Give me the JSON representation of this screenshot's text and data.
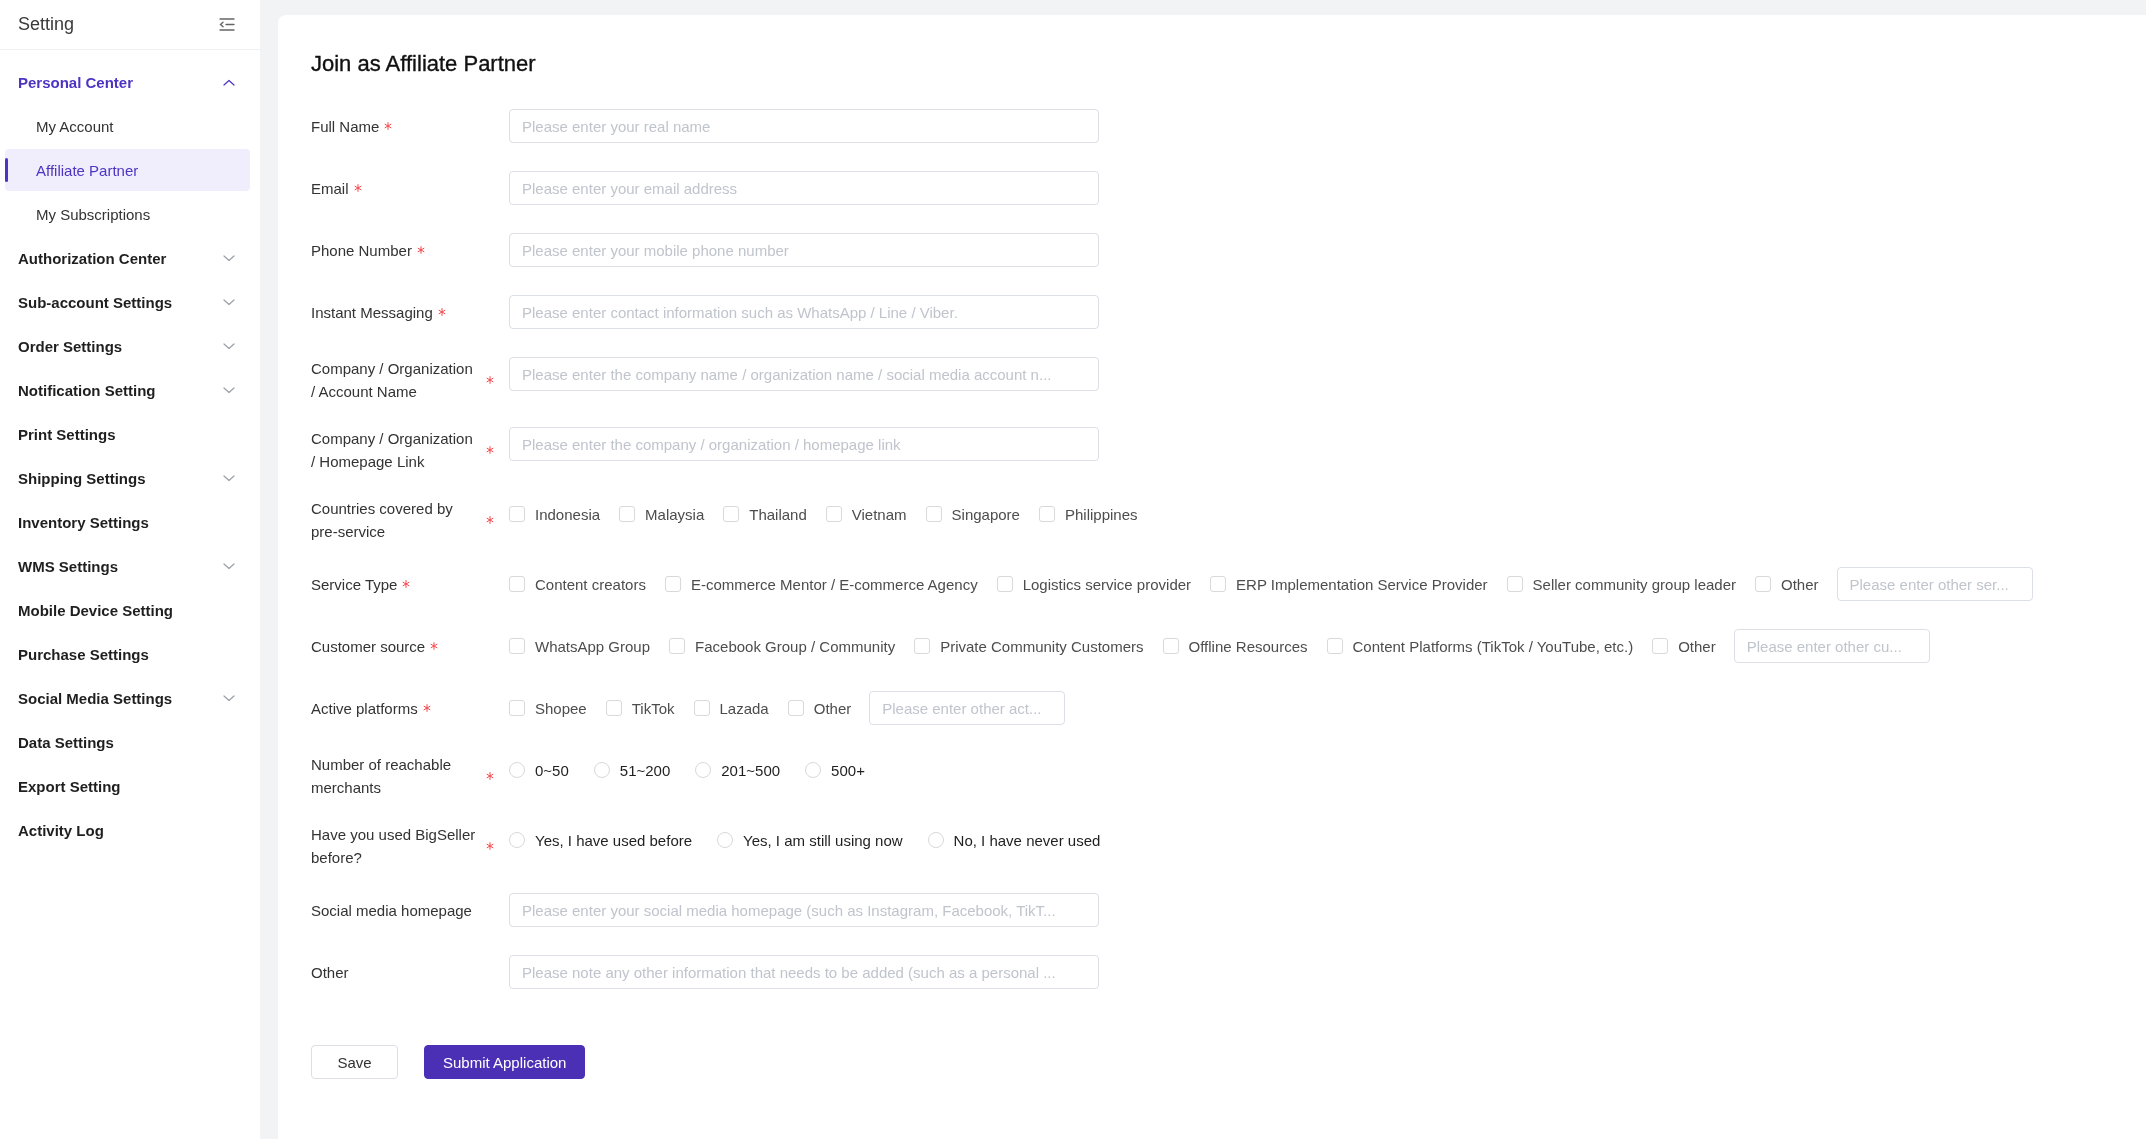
{
  "sidebar": {
    "title": "Setting",
    "items": [
      {
        "kind": "group",
        "label": "Personal Center",
        "expanded": true,
        "children": [
          {
            "label": "My Account",
            "selected": false
          },
          {
            "label": "Affiliate Partner",
            "selected": true
          },
          {
            "label": "My Subscriptions",
            "selected": false
          }
        ]
      },
      {
        "kind": "group",
        "label": "Authorization Center",
        "expanded": false
      },
      {
        "kind": "group",
        "label": "Sub-account Settings",
        "expanded": false
      },
      {
        "kind": "group",
        "label": "Order Settings",
        "expanded": false
      },
      {
        "kind": "group",
        "label": "Notification Setting",
        "expanded": false
      },
      {
        "kind": "link",
        "label": "Print Settings",
        "selected": false
      },
      {
        "kind": "group",
        "label": "Shipping Settings",
        "expanded": false
      },
      {
        "kind": "link",
        "label": "Inventory Settings",
        "selected": false
      },
      {
        "kind": "group",
        "label": "WMS Settings",
        "expanded": false
      },
      {
        "kind": "link",
        "label": "Mobile Device Setting",
        "selected": false
      },
      {
        "kind": "link",
        "label": "Purchase Settings",
        "selected": false
      },
      {
        "kind": "group",
        "label": "Social Media Settings",
        "expanded": false
      },
      {
        "kind": "link",
        "label": "Data Settings",
        "selected": false
      },
      {
        "kind": "link",
        "label": "Export Setting",
        "selected": false
      },
      {
        "kind": "link",
        "label": "Activity Log",
        "selected": false
      }
    ]
  },
  "form": {
    "title": "Join as Affiliate Partner",
    "fields": [
      {
        "kind": "text",
        "label": "Full Name",
        "required": true,
        "placeholder": "Please enter your real name"
      },
      {
        "kind": "text",
        "label": "Email",
        "required": true,
        "placeholder": "Please enter your email address"
      },
      {
        "kind": "text",
        "label": "Phone Number",
        "required": true,
        "placeholder": "Please enter your mobile phone number"
      },
      {
        "kind": "text",
        "label": "Instant Messaging",
        "required": true,
        "placeholder": "Please enter contact information such as WhatsApp / Line / Viber."
      },
      {
        "kind": "text",
        "label": "Company / Organization / Account Name",
        "required": true,
        "placeholder": "Please enter the company name / organization name / social media account n..."
      },
      {
        "kind": "text",
        "label": "Company / Organization / Homepage Link",
        "required": true,
        "placeholder": "Please enter the company / organization / homepage link"
      },
      {
        "kind": "checkboxes",
        "label": "Countries covered by pre-service",
        "required": true,
        "options": [
          {
            "label": "Indonesia",
            "checked": false
          },
          {
            "label": "Malaysia",
            "checked": false
          },
          {
            "label": "Thailand",
            "checked": false
          },
          {
            "label": "Vietnam",
            "checked": false
          },
          {
            "label": "Singapore",
            "checked": false
          },
          {
            "label": "Philippines",
            "checked": false
          }
        ]
      },
      {
        "kind": "checkboxes",
        "label": "Service Type",
        "required": true,
        "options": [
          {
            "label": "Content creators",
            "checked": false
          },
          {
            "label": "E-commerce Mentor / E-commerce Agency",
            "checked": false
          },
          {
            "label": "Logistics service provider",
            "checked": false
          },
          {
            "label": "ERP Implementation Service Provider",
            "checked": false
          },
          {
            "label": "Seller community group leader",
            "checked": false
          },
          {
            "label": "Other",
            "checked": false
          }
        ],
        "other_field": {
          "placeholder": "Please enter other ser..."
        }
      },
      {
        "kind": "checkboxes",
        "label": "Customer source",
        "required": true,
        "options": [
          {
            "label": "WhatsApp Group",
            "checked": false
          },
          {
            "label": "Facebook Group / Community",
            "checked": false
          },
          {
            "label": "Private Community Customers",
            "checked": false
          },
          {
            "label": "Offline Resources",
            "checked": false
          },
          {
            "label": "Content Platforms (TikTok / YouTube, etc.)",
            "checked": false
          },
          {
            "label": "Other",
            "checked": false
          }
        ],
        "other_field": {
          "placeholder": "Please enter other cu..."
        }
      },
      {
        "kind": "checkboxes",
        "label": "Active platforms",
        "required": true,
        "options": [
          {
            "label": "Shopee",
            "checked": false
          },
          {
            "label": "TikTok",
            "checked": false
          },
          {
            "label": "Lazada",
            "checked": false
          },
          {
            "label": "Other",
            "checked": false
          }
        ],
        "other_field": {
          "placeholder": "Please enter other act..."
        }
      },
      {
        "kind": "radios",
        "label": "Number of reachable merchants",
        "required": true,
        "options": [
          {
            "label": "0~50",
            "selected": false
          },
          {
            "label": "51~200",
            "selected": false
          },
          {
            "label": "201~500",
            "selected": false
          },
          {
            "label": "500+",
            "selected": false
          }
        ]
      },
      {
        "kind": "radios",
        "label": "Have you used BigSeller before?",
        "required": true,
        "options": [
          {
            "label": "Yes, I have used before",
            "selected": false
          },
          {
            "label": "Yes, I am still using now",
            "selected": false
          },
          {
            "label": "No, I have never used",
            "selected": false
          }
        ]
      },
      {
        "kind": "text",
        "label": "Social media homepage",
        "required": false,
        "placeholder": "Please enter your social media homepage (such as Instagram, Facebook, TikT..."
      },
      {
        "kind": "text",
        "label": "Other",
        "required": false,
        "placeholder": "Please note any other information that needs to be added (such as a personal ..."
      }
    ],
    "buttons": [
      {
        "kind": "default",
        "label": "Save"
      },
      {
        "kind": "primary",
        "label": "Submit Application"
      }
    ]
  }
}
